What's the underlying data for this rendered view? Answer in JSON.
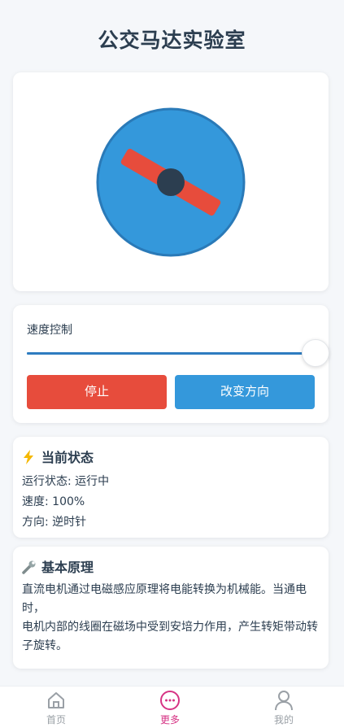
{
  "header": {
    "title": "公交马达实验室"
  },
  "controls": {
    "speed_label": "速度控制",
    "speed_value": 1.0,
    "stop_label": "停止",
    "direction_label": "改变方向"
  },
  "status": {
    "icon": "lightning-icon",
    "title": "当前状态",
    "run_state": "运行状态: 运行中",
    "speed": "速度: 100%",
    "direction": "方向: 逆时针"
  },
  "principle": {
    "icon": "wrench-icon",
    "title": "基本原理",
    "line1": "直流电机通过电磁感应原理将电能转换为机械能。当通电时，",
    "line2": "电机内部的线圈在磁场中受到安培力作用，产生转矩带动转子旋转。"
  },
  "tabbar": {
    "home_label": "首页",
    "more_label": "更多",
    "mine_label": "我的"
  },
  "colors": {
    "motor_body": "#3498db",
    "rotor": "#e74c3c",
    "hub": "#2c3e50",
    "accent_active_tab": "#d63384"
  }
}
